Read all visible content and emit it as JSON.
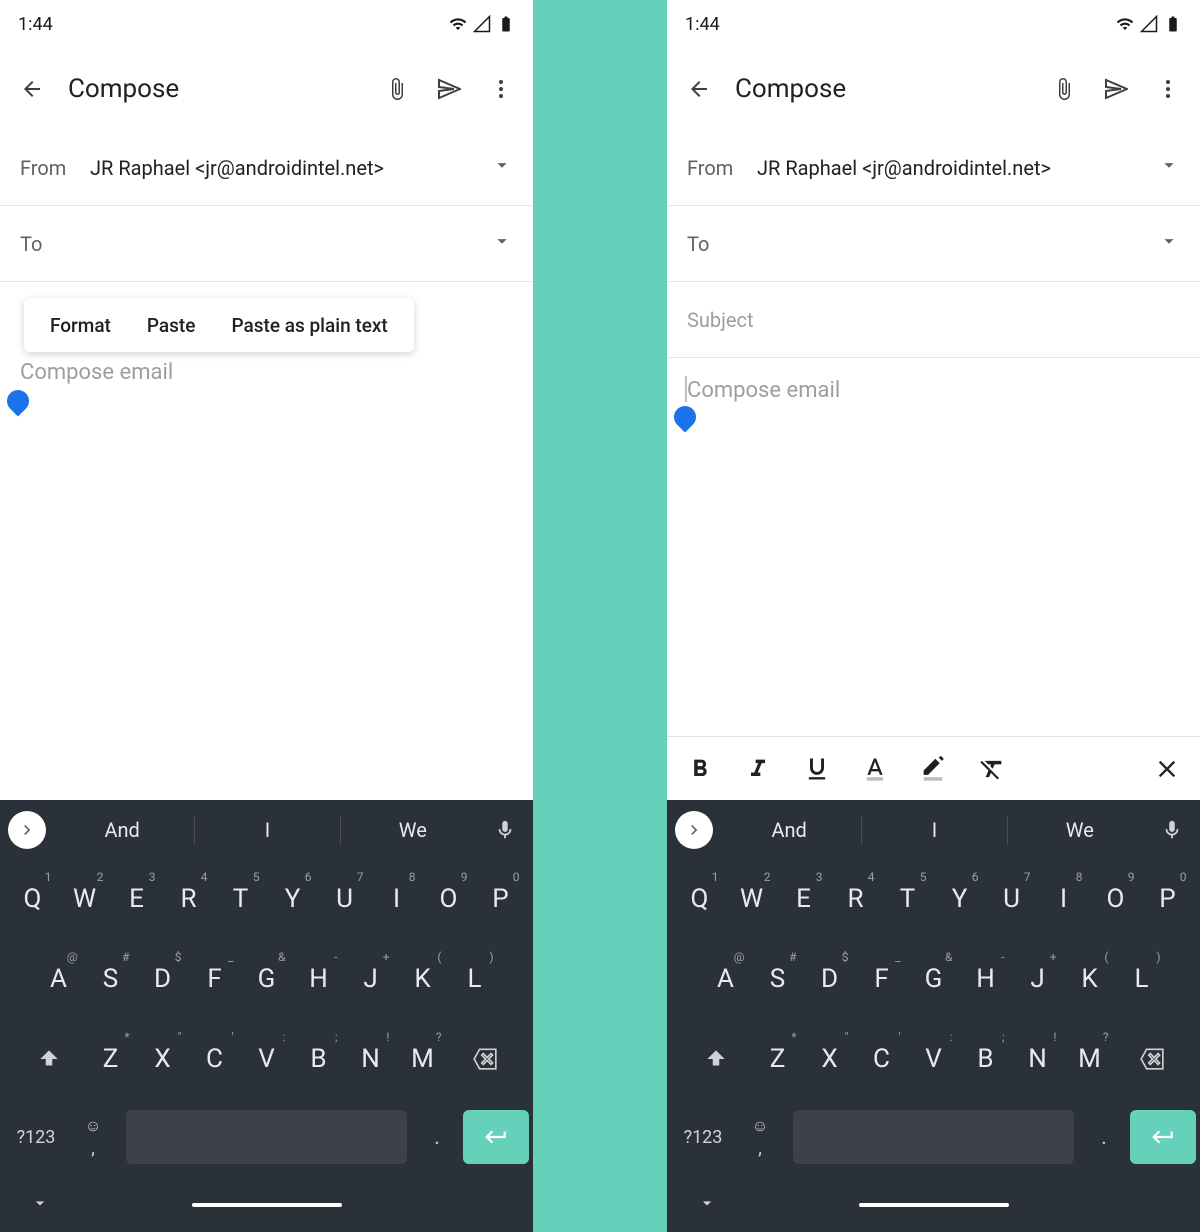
{
  "status": {
    "time": "1:44"
  },
  "appbar": {
    "title": "Compose"
  },
  "from": {
    "label": "From",
    "value": "JR Raphael <jr@androidintel.net>"
  },
  "to": {
    "label": "To"
  },
  "subject": {
    "placeholder": "Subject"
  },
  "body": {
    "placeholder": "Compose email"
  },
  "context_menu": {
    "format": "Format",
    "paste": "Paste",
    "paste_plain": "Paste as plain text"
  },
  "keyboard": {
    "suggestions": [
      "And",
      "I",
      "We"
    ],
    "row1": [
      {
        "k": "Q",
        "s": "1"
      },
      {
        "k": "W",
        "s": "2"
      },
      {
        "k": "E",
        "s": "3"
      },
      {
        "k": "R",
        "s": "4"
      },
      {
        "k": "T",
        "s": "5"
      },
      {
        "k": "Y",
        "s": "6"
      },
      {
        "k": "U",
        "s": "7"
      },
      {
        "k": "I",
        "s": "8"
      },
      {
        "k": "O",
        "s": "9"
      },
      {
        "k": "P",
        "s": "0"
      }
    ],
    "row2": [
      {
        "k": "A",
        "s": "@"
      },
      {
        "k": "S",
        "s": "#"
      },
      {
        "k": "D",
        "s": "$"
      },
      {
        "k": "F",
        "s": "_"
      },
      {
        "k": "G",
        "s": "&"
      },
      {
        "k": "H",
        "s": "-"
      },
      {
        "k": "J",
        "s": "+"
      },
      {
        "k": "K",
        "s": "("
      },
      {
        "k": "L",
        "s": ")"
      }
    ],
    "row3": [
      {
        "k": "Z",
        "s": "*"
      },
      {
        "k": "X",
        "s": "\""
      },
      {
        "k": "C",
        "s": "'"
      },
      {
        "k": "V",
        "s": ":"
      },
      {
        "k": "B",
        "s": ";"
      },
      {
        "k": "N",
        "s": "!"
      },
      {
        "k": "M",
        "s": "?"
      }
    ],
    "sym": "?123",
    "comma": ",",
    "dot": "."
  }
}
